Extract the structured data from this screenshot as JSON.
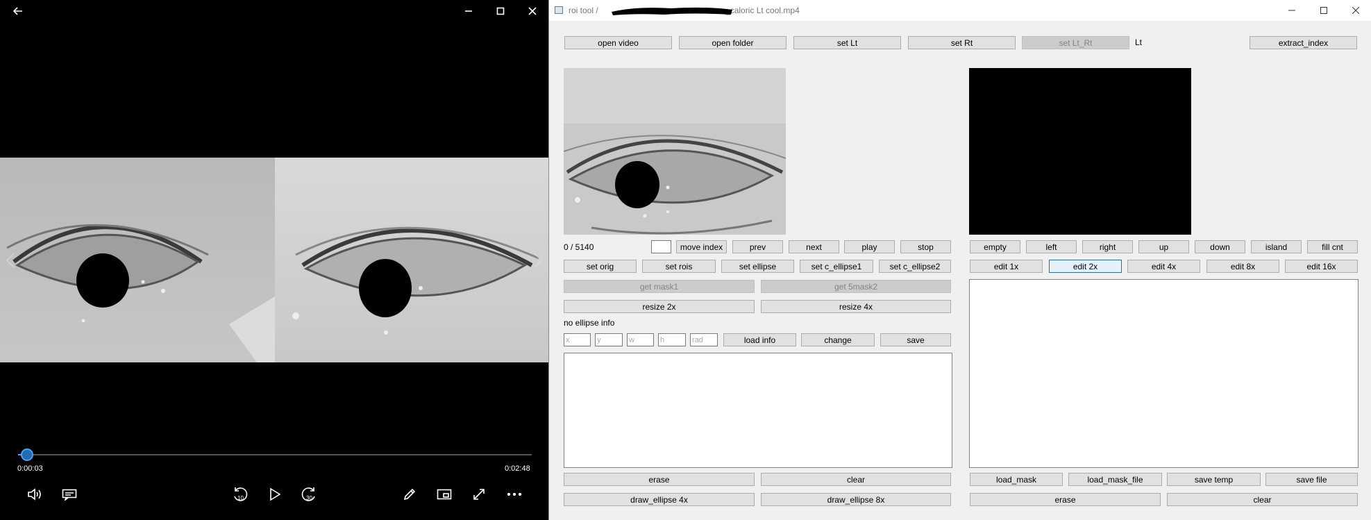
{
  "player": {
    "current_time": "0:00:03",
    "total_time": "0:02:48",
    "progress_fraction": 0.018,
    "skip_back_label": "10",
    "skip_forward_label": "30",
    "icons": [
      "back-arrow-icon",
      "minimize-icon",
      "maximize-icon",
      "close-icon",
      "prev-arrow-icon",
      "next-arrow-icon",
      "volume-icon",
      "subtitles-icon",
      "skip-back-icon",
      "play-icon",
      "skip-forward-icon",
      "pen-icon",
      "mini-view-icon",
      "fullscreen-icon",
      "more-icon"
    ]
  },
  "roi_tool": {
    "title": "roi tool / ",
    "title_suffix": "_caloric Lt cool.mp4",
    "top_buttons": {
      "open_video": "open video",
      "open_folder": "open folder",
      "set_lt": "set Lt",
      "set_rt": "set Rt",
      "set_lt_rt": "set Lt_Rt",
      "side_label": "Lt",
      "extract_index": "extract_index"
    },
    "frame_counter": "0 / 5140",
    "index_input_value": "",
    "nav_buttons": {
      "move_index": "move index",
      "prev": "prev",
      "next": "next",
      "play": "play",
      "stop": "stop"
    },
    "set_buttons": {
      "set_orig": "set orig",
      "set_rois": "set rois",
      "set_ellipse": "set ellipse",
      "set_c_ellipse1": "set c_ellipse1",
      "set_c_ellipse2": "set c_ellipse2"
    },
    "mask_buttons": {
      "get_mask1": "get mask1",
      "get_5mask2": "get 5mask2",
      "resize_2x": "resize 2x",
      "resize_4x": "resize 4x"
    },
    "ellipse_info": "no ellipse info",
    "ellipse_fields": {
      "x": "x",
      "y": "y",
      "w": "w",
      "h": "h",
      "rad": "rad"
    },
    "ellipse_buttons": {
      "load_info": "load info",
      "change": "change",
      "save": "save"
    },
    "left_bottom_buttons": {
      "erase": "erase",
      "clear": "clear",
      "draw_ellipse_4x": "draw_ellipse 4x",
      "draw_ellipse_8x": "draw_ellipse 8x"
    },
    "direction_buttons": {
      "empty": "empty",
      "left": "left",
      "right": "right",
      "up": "up",
      "down": "down",
      "island": "island",
      "fill_cnt": "fill cnt"
    },
    "edit_buttons": {
      "edit_1x": "edit 1x",
      "edit_2x": "edit 2x",
      "edit_4x": "edit 4x",
      "edit_8x": "edit 8x",
      "edit_16x": "edit 16x"
    },
    "right_bottom_buttons": {
      "load_mask": "load_mask",
      "load_mask_file": "load_mask_file",
      "save_temp": "save temp",
      "save_file": "save file",
      "erase": "erase",
      "clear": "clear"
    }
  },
  "colors": {
    "seek_accent": "#4aa3f0",
    "window_bg": "#f0f0f0",
    "button_bg": "#e1e1e1",
    "focus_border": "#0078d7"
  }
}
